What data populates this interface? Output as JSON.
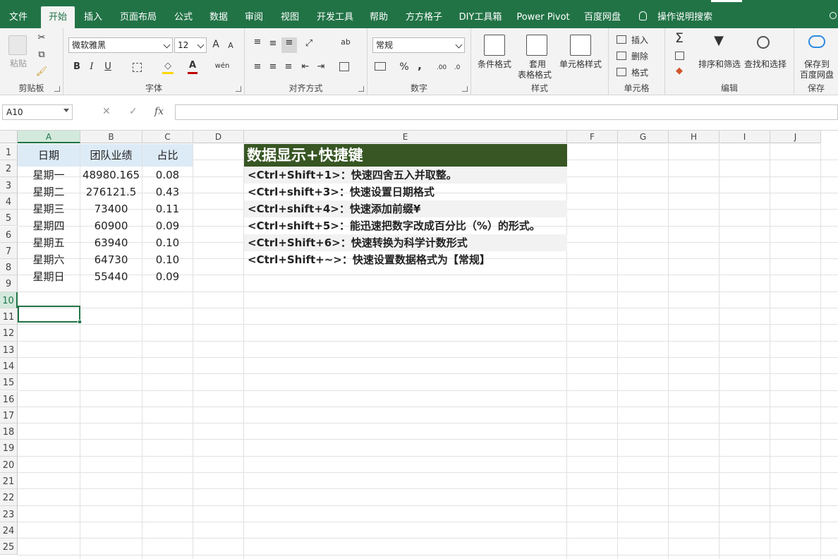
{
  "ribbon_tabs": [
    "文件",
    "开始",
    "插入",
    "页面布局",
    "公式",
    "数据",
    "审阅",
    "视图",
    "开发工具",
    "帮助",
    "方方格子",
    "DIY工具箱",
    "Power Pivot",
    "百度网盘"
  ],
  "tell_me": "操作说明搜索",
  "clipboard": {
    "paste": "粘贴",
    "group": "剪贴板"
  },
  "font": {
    "name": "微软雅黑",
    "size": "12",
    "group": "字体",
    "bold": "B",
    "italic": "I",
    "underline": "U",
    "grow": "A",
    "shrink": "A",
    "color_letter": "A",
    "wen": "wén"
  },
  "alignment": {
    "group": "对齐方式",
    "wrap": "ab"
  },
  "number": {
    "format": "常规",
    "group": "数字",
    "percent": "%",
    "comma": ","
  },
  "styles": {
    "conditional": "条件格式",
    "table_a": "套用",
    "table_b": "表格格式",
    "cell_styles": "单元格样式",
    "group": "样式"
  },
  "cells": {
    "insert": "插入",
    "delete": "删除",
    "format": "格式",
    "group": "单元格"
  },
  "editing": {
    "sort": "排序和筛选",
    "find": "查找和选择",
    "group": "编辑",
    "sum": "Σ"
  },
  "save": {
    "line1": "保存到",
    "line2": "百度网盘",
    "group": "保存"
  },
  "name_box": "A10",
  "fx_label": "fx",
  "columns": [
    "A",
    "B",
    "C",
    "D",
    "E",
    "F",
    "G",
    "H",
    "I",
    "J"
  ],
  "rows": [
    "1",
    "2",
    "3",
    "4",
    "5",
    "6",
    "7",
    "8",
    "9",
    "10",
    "11",
    "12",
    "13",
    "14",
    "15",
    "16",
    "17",
    "18",
    "19",
    "20",
    "21",
    "22",
    "23",
    "24",
    "25"
  ],
  "table": {
    "headers": [
      "日期",
      "团队业绩",
      "占比"
    ],
    "rows": [
      [
        "星期一",
        "48980.165",
        "0.08"
      ],
      [
        "星期二",
        "276121.5",
        "0.43"
      ],
      [
        "星期三",
        "73400",
        "0.11"
      ],
      [
        "星期四",
        "60900",
        "0.09"
      ],
      [
        "星期五",
        "63940",
        "0.10"
      ],
      [
        "星期六",
        "64730",
        "0.10"
      ],
      [
        "星期日",
        "55440",
        "0.09"
      ]
    ]
  },
  "shortcuts": {
    "title": "数据显示+快捷键",
    "items": [
      "<Ctrl+Shift+1>：快速四舍五入并取整。",
      "<Ctrl+shift+3>：快速设置日期格式",
      "<Ctrl+shift+4>：快速添加前缀¥",
      "<Ctrl+shift+5>：能迅速把数字改成百分比（%）的形式。",
      "<Ctrl+Shift+6>：快速转换为科学计数形式",
      "<Ctrl+Shift+~>：快速设置数据格式为【常规】"
    ]
  },
  "colors": {
    "accent": "#217346",
    "header_fill": "#ddebf7",
    "title_fill": "#375623",
    "zebra": "#f2f2f2"
  }
}
